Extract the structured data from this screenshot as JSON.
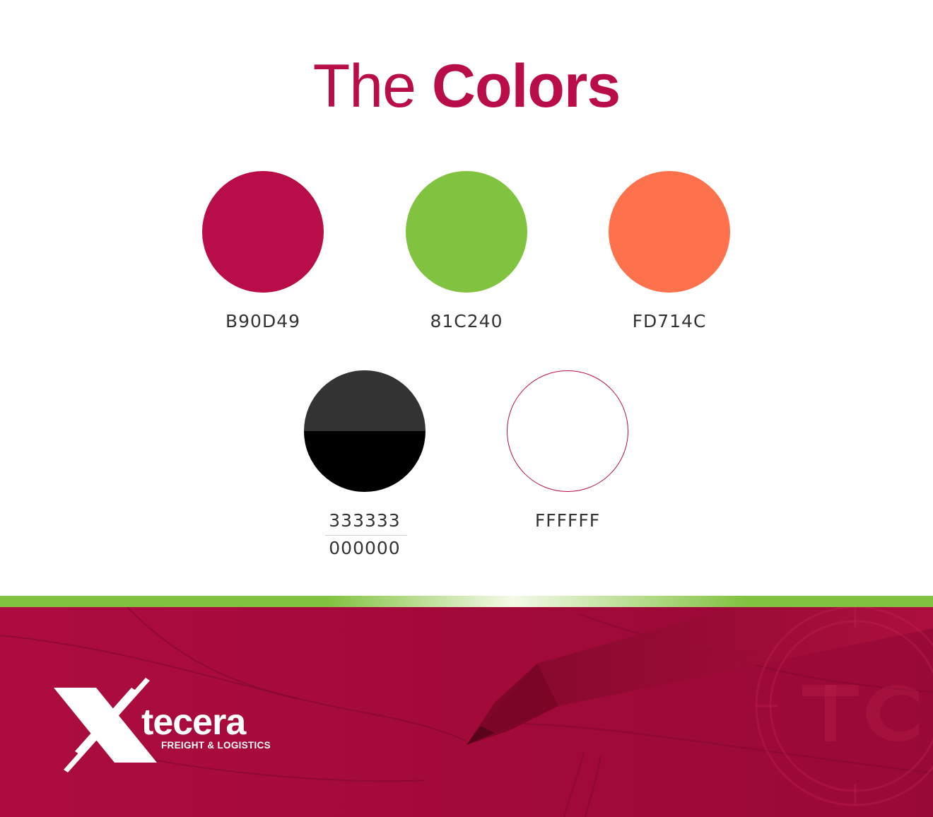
{
  "title": {
    "light": "The",
    "bold": "Colors"
  },
  "swatches": [
    {
      "label": "B90D49",
      "color": "#b90d49"
    },
    {
      "label": "81C240",
      "color": "#81c240"
    },
    {
      "label": "FD714C",
      "color": "#fd714c"
    },
    {
      "label": "333333",
      "label2": "000000",
      "color": "#333333",
      "color2": "#000000"
    },
    {
      "label": "FFFFFF",
      "color": "#ffffff",
      "outline": "#b90d49"
    }
  ],
  "brand": {
    "name": "tecera",
    "tagline": "FREIGHT & LOGISTICS",
    "footer_color": "#a50a3c",
    "band_color": "#81c240"
  }
}
